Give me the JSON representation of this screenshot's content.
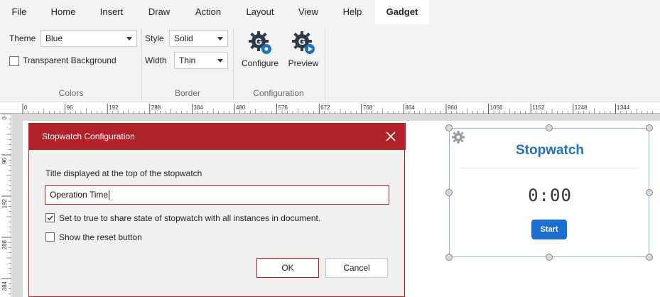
{
  "ribbon_tabs": [
    {
      "label": "File"
    },
    {
      "label": "Home"
    },
    {
      "label": "Insert"
    },
    {
      "label": "Draw"
    },
    {
      "label": "Action"
    },
    {
      "label": "Layout"
    },
    {
      "label": "View"
    },
    {
      "label": "Help"
    },
    {
      "label": "Gadget",
      "active": true
    }
  ],
  "colors_group": {
    "theme_label": "Theme",
    "theme_value": "Blue",
    "transparent_label": "Transparent Background",
    "transparent_checked": false,
    "group_label": "Colors"
  },
  "border_group": {
    "style_label": "Style",
    "style_value": "Solid",
    "width_label": "Width",
    "width_value": "Thin",
    "group_label": "Border"
  },
  "configuration_group": {
    "configure_label": "Configure",
    "preview_label": "Preview",
    "group_label": "Configuration"
  },
  "ruler": {
    "h_ticks": [
      "0",
      "96",
      "192",
      "288",
      "384",
      "480",
      "576",
      "672",
      "768",
      "864",
      "960",
      "1056",
      "1152",
      "1248",
      "1344"
    ],
    "v_ticks": [
      "0",
      "96",
      "192",
      "288",
      "384"
    ]
  },
  "dialog": {
    "title": "Stopwatch Configuration",
    "field_label": "Title displayed at the top of the stopwatch",
    "title_value": "Operation Time",
    "share_label": "Set to true to share state of stopwatch with all instances in document.",
    "share_checked": true,
    "reset_label": "Show the reset button",
    "reset_checked": false,
    "ok_label": "OK",
    "cancel_label": "Cancel"
  },
  "stopwatch": {
    "title": "Stopwatch",
    "time": "0:00",
    "start_label": "Start"
  },
  "colors": {
    "accent_red": "#b22228",
    "stopwatch_blue": "#1e73be",
    "start_button": "#1d6fcf"
  }
}
